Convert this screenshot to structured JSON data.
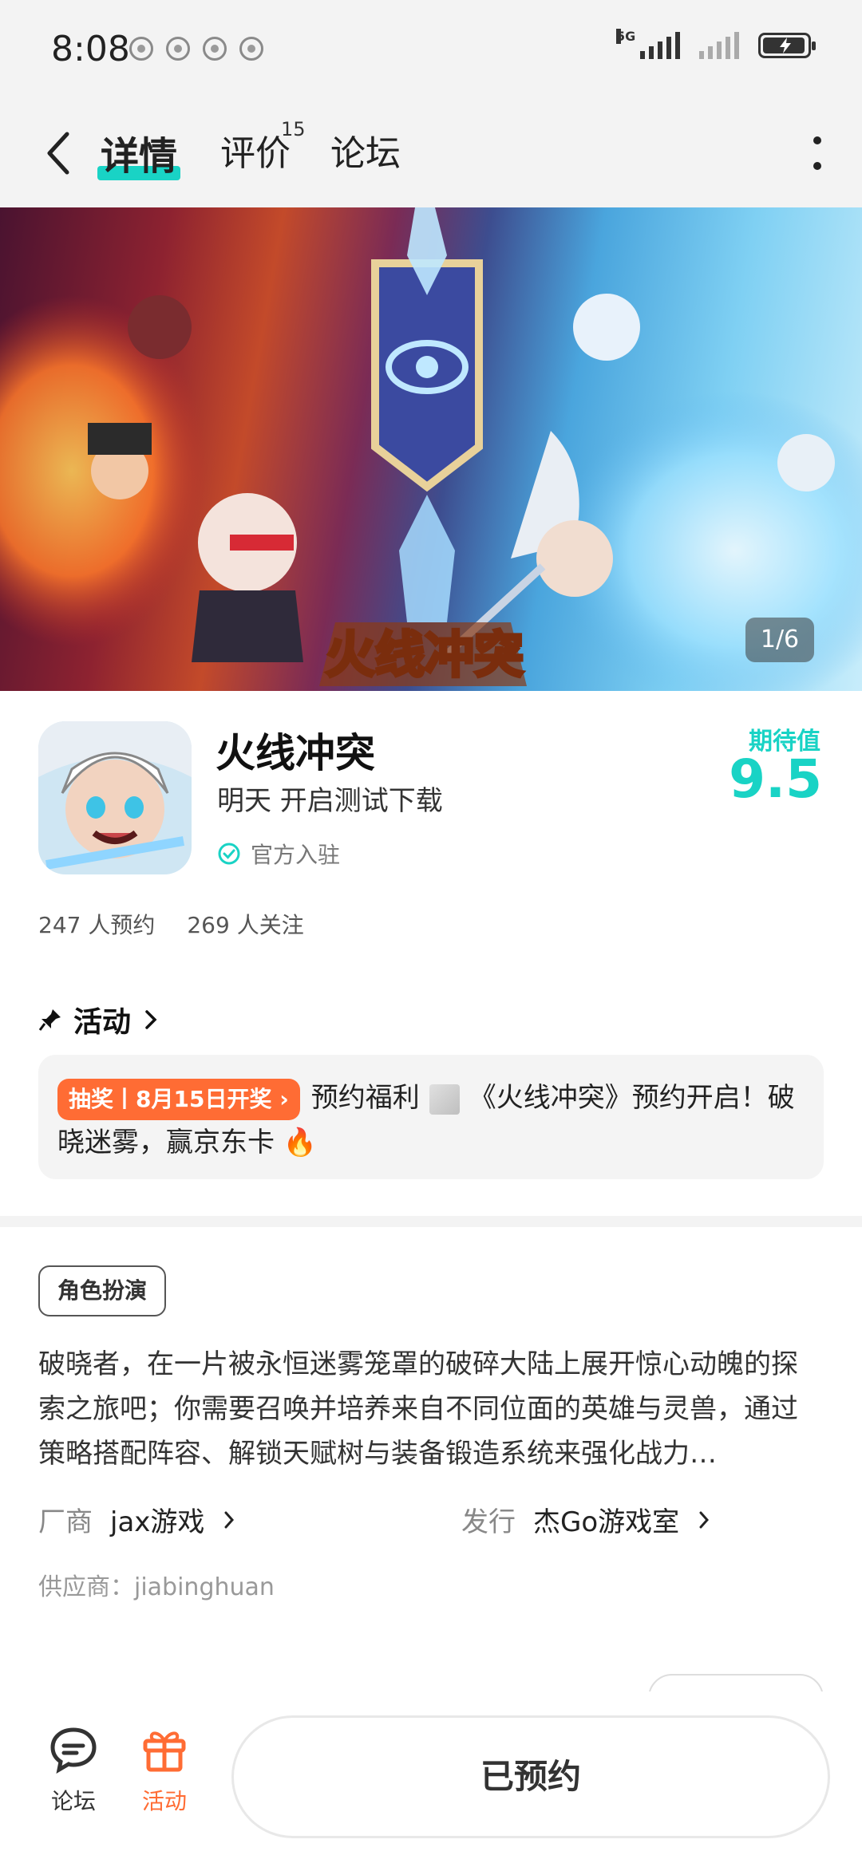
{
  "status_bar": {
    "time": "8:08",
    "network": "5G",
    "notification_icons": [
      "app-notification-icon",
      "app-notification-icon",
      "app-notification-icon",
      "app-notification-icon"
    ]
  },
  "nav": {
    "tabs": [
      {
        "label": "详情",
        "active": true
      },
      {
        "label": "评价",
        "badge": "15"
      },
      {
        "label": "论坛"
      }
    ]
  },
  "hero": {
    "counter": "1/6"
  },
  "app": {
    "name": "火线冲突",
    "subtitle": "明天 开启测试下载",
    "official": "官方入驻",
    "score_label": "期待值",
    "score": "9.5",
    "reservations": "247 人预约",
    "followers": "269 人关注"
  },
  "activity": {
    "title": "活动",
    "tag": "抽奖丨8月15日开奖 ›",
    "text_before": "预约福利",
    "text_after": "《火线冲突》预约开启！破晓迷雾，赢京东卡 🔥"
  },
  "details": {
    "genre": "角色扮演",
    "description": "破晓者，在一片被永恒迷雾笼罩的破碎大陆上展开惊心动魄的探索之旅吧；你需要召唤并培养来自不同位面的英雄与灵兽，通过策略搭配阵容、解锁天赋树与装备锻造系统来强化战力…",
    "developer_label": "厂商",
    "developer": "jax游戏",
    "publisher_label": "发行",
    "publisher": "杰Go游戏室",
    "supplier": "供应商：jiabinghuan"
  },
  "bottom": {
    "forum_label": "论坛",
    "activity_label": "活动",
    "reserve_label": "已预约",
    "accent": "#19d3c5",
    "activity_color": "#ff6c34"
  }
}
